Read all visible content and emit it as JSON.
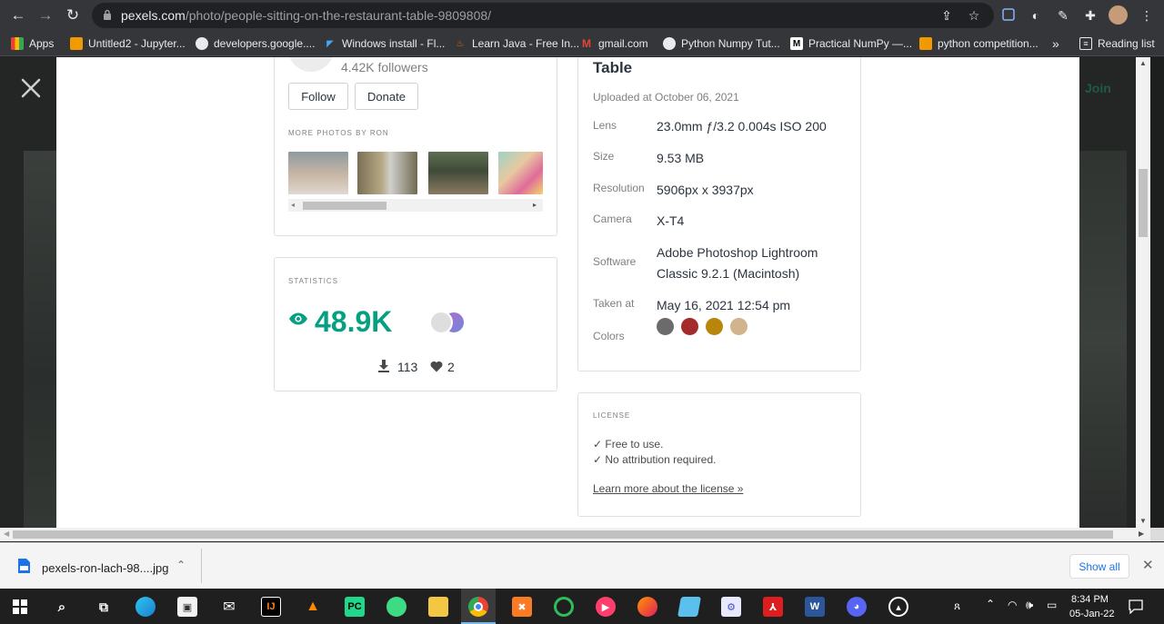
{
  "browser": {
    "url_domain": "pexels.com",
    "url_path": "/photo/people-sitting-on-the-restaurant-table-9809808/",
    "bookmarks": [
      {
        "label": "Apps"
      },
      {
        "label": "Untitled2 - Jupyter..."
      },
      {
        "label": "developers.google...."
      },
      {
        "label": "Windows install - Fl..."
      },
      {
        "label": "Learn Java - Free In..."
      },
      {
        "label": "gmail.com"
      },
      {
        "label": "Python Numpy Tut..."
      },
      {
        "label": "Practical NumPy —..."
      },
      {
        "label": "python competition..."
      }
    ],
    "bookmarks_overflow": "»",
    "reading_list": "Reading list"
  },
  "backdrop": {
    "join_label": "Join"
  },
  "photographer": {
    "followers": "4.42K followers",
    "follow_label": "Follow",
    "donate_label": "Donate",
    "more_photos_label": "MORE PHOTOS BY RON"
  },
  "statistics": {
    "title": "STATISTICS",
    "views": "48.9K",
    "downloads": "113",
    "likes": "2"
  },
  "details": {
    "title_tail": "Table",
    "uploaded": "Uploaded at October 06, 2021",
    "rows": [
      {
        "label": "Lens",
        "value": "23.0mm ƒ/3.2 0.004s ISO 200"
      },
      {
        "label": "Size",
        "value": "9.53 MB"
      },
      {
        "label": "Resolution",
        "value": "5906px x 3937px"
      },
      {
        "label": "Camera",
        "value": "X-T4"
      },
      {
        "label": "Software",
        "value": "Adobe Photoshop Lightroom Classic 9.2.1 (Macintosh)"
      },
      {
        "label": "Taken at",
        "value": "May 16, 2021 12:54 pm"
      }
    ],
    "colors_label": "Colors",
    "colors": [
      "#6b6b6b",
      "#a52a2a",
      "#b8860b",
      "#d2b48c"
    ]
  },
  "license": {
    "title": "LICENSE",
    "line1": "✓ Free to use.",
    "line2": "✓ No attribution required.",
    "link": "Learn more about the license »"
  },
  "download": {
    "filename": "pexels-ron-lach-98....jpg",
    "show_all": "Show all"
  },
  "taskbar": {
    "time": "8:34 PM",
    "date": "05-Jan-22"
  }
}
